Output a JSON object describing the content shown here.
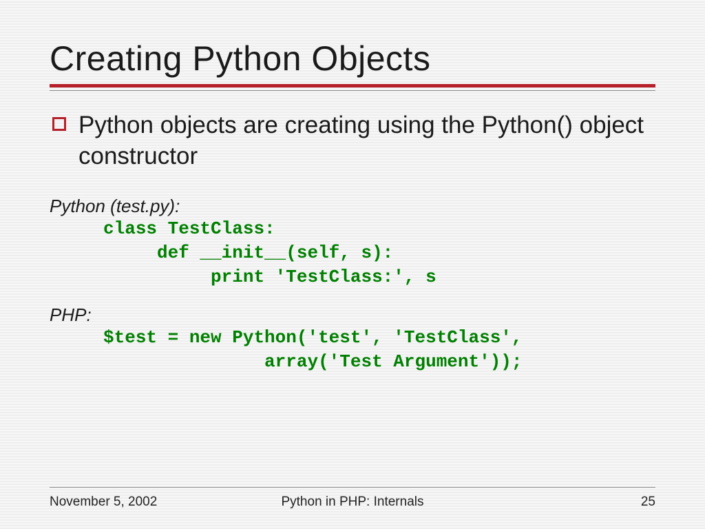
{
  "title": "Creating Python Objects",
  "bullet": "Python objects are creating using the Python() object constructor",
  "python_label": "Python (test.py):",
  "python_code": "     class TestClass:\n          def __init__(self, s):\n               print 'TestClass:', s",
  "php_label": "PHP:",
  "php_code": "     $test = new Python('test', 'TestClass',\n                    array('Test Argument'));",
  "footer": {
    "date": "November 5, 2002",
    "center": "Python in PHP: Internals",
    "page": "25"
  }
}
